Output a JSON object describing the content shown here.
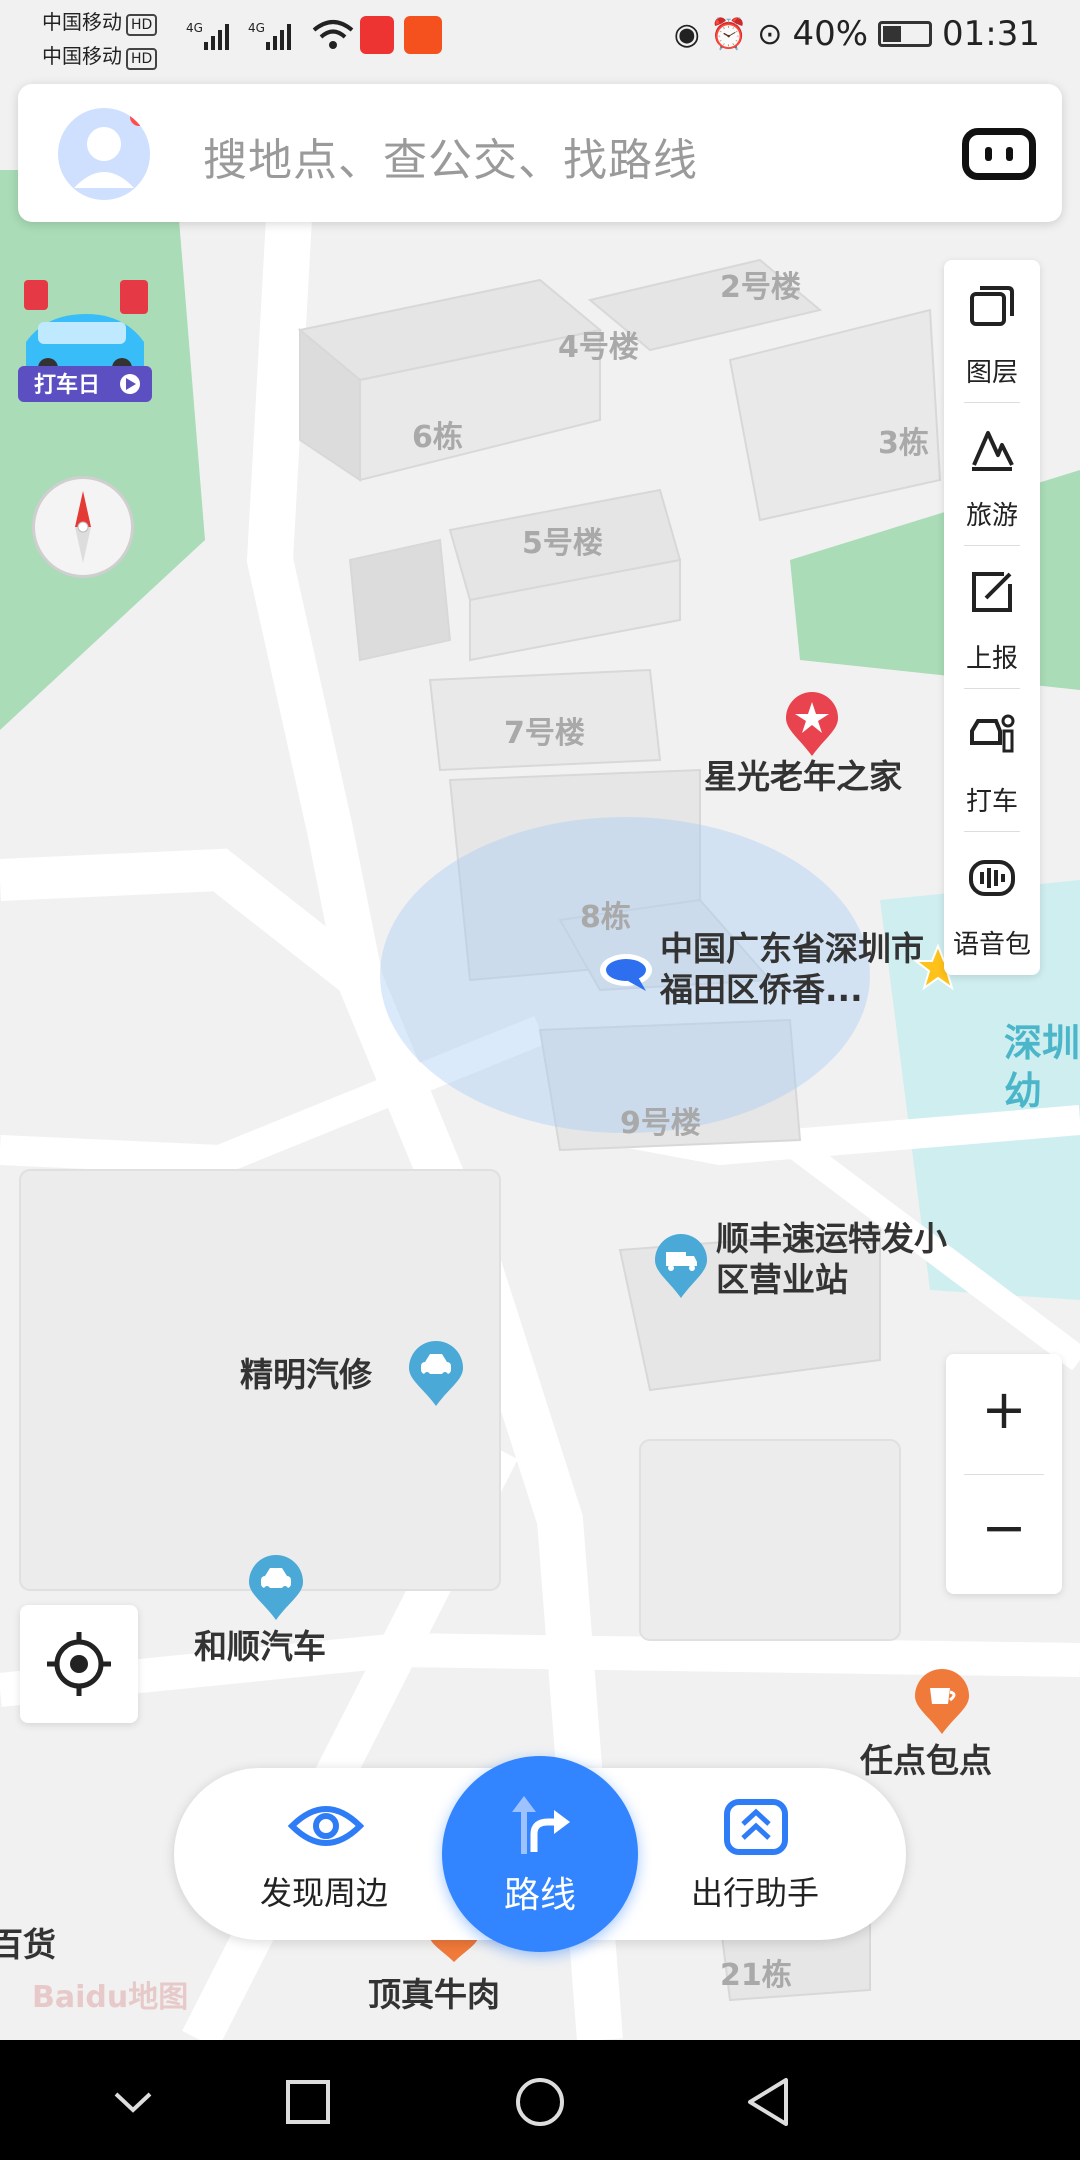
{
  "status_bar": {
    "carrier1": "中国移动",
    "carrier2": "中国移动",
    "hd": "HD",
    "battery": "40%",
    "time": "01:31"
  },
  "search": {
    "placeholder": "搜地点、查公交、找路线"
  },
  "promo": {
    "label": "打车日"
  },
  "right_panel": {
    "items": [
      {
        "label": "图层",
        "icon": "layers-icon"
      },
      {
        "label": "旅游",
        "icon": "travel-icon"
      },
      {
        "label": "上报",
        "icon": "report-icon"
      },
      {
        "label": "打车",
        "icon": "taxi-icon"
      },
      {
        "label": "语音包",
        "icon": "voice-pack-icon"
      }
    ]
  },
  "zoom": {
    "plus": "+",
    "minus": "−"
  },
  "map": {
    "buildings": [
      "2号楼",
      "4号楼",
      "6栋",
      "3栋",
      "5号楼",
      "7号楼",
      "8栋",
      "9号楼",
      "21栋"
    ],
    "pois": [
      {
        "name": "星光老年之家",
        "icon": "star-pin-icon"
      },
      {
        "name": "中国广东省深圳市福田区侨香...",
        "icon": "location-arrow-icon"
      },
      {
        "name": "深圳幼",
        "icon": "kindergarten-icon"
      },
      {
        "name": "顺丰速运特发小区营业站",
        "icon": "delivery-truck-icon"
      },
      {
        "name": "精明汽修",
        "icon": "car-repair-icon"
      },
      {
        "name": "和顺汽车",
        "icon": "car-icon"
      },
      {
        "name": "任点包点",
        "icon": "cafe-icon"
      },
      {
        "name": "顶真牛肉",
        "icon": "food-icon"
      },
      {
        "name": "百货",
        "icon": ""
      }
    ],
    "watermark": "Baidu地图"
  },
  "bottom_bar": {
    "discover": "发现周边",
    "route": "路线",
    "assistant": "出行助手"
  },
  "colors": {
    "accent": "#3385ff",
    "park": "#a9dcb7",
    "water": "#cfeef0"
  }
}
